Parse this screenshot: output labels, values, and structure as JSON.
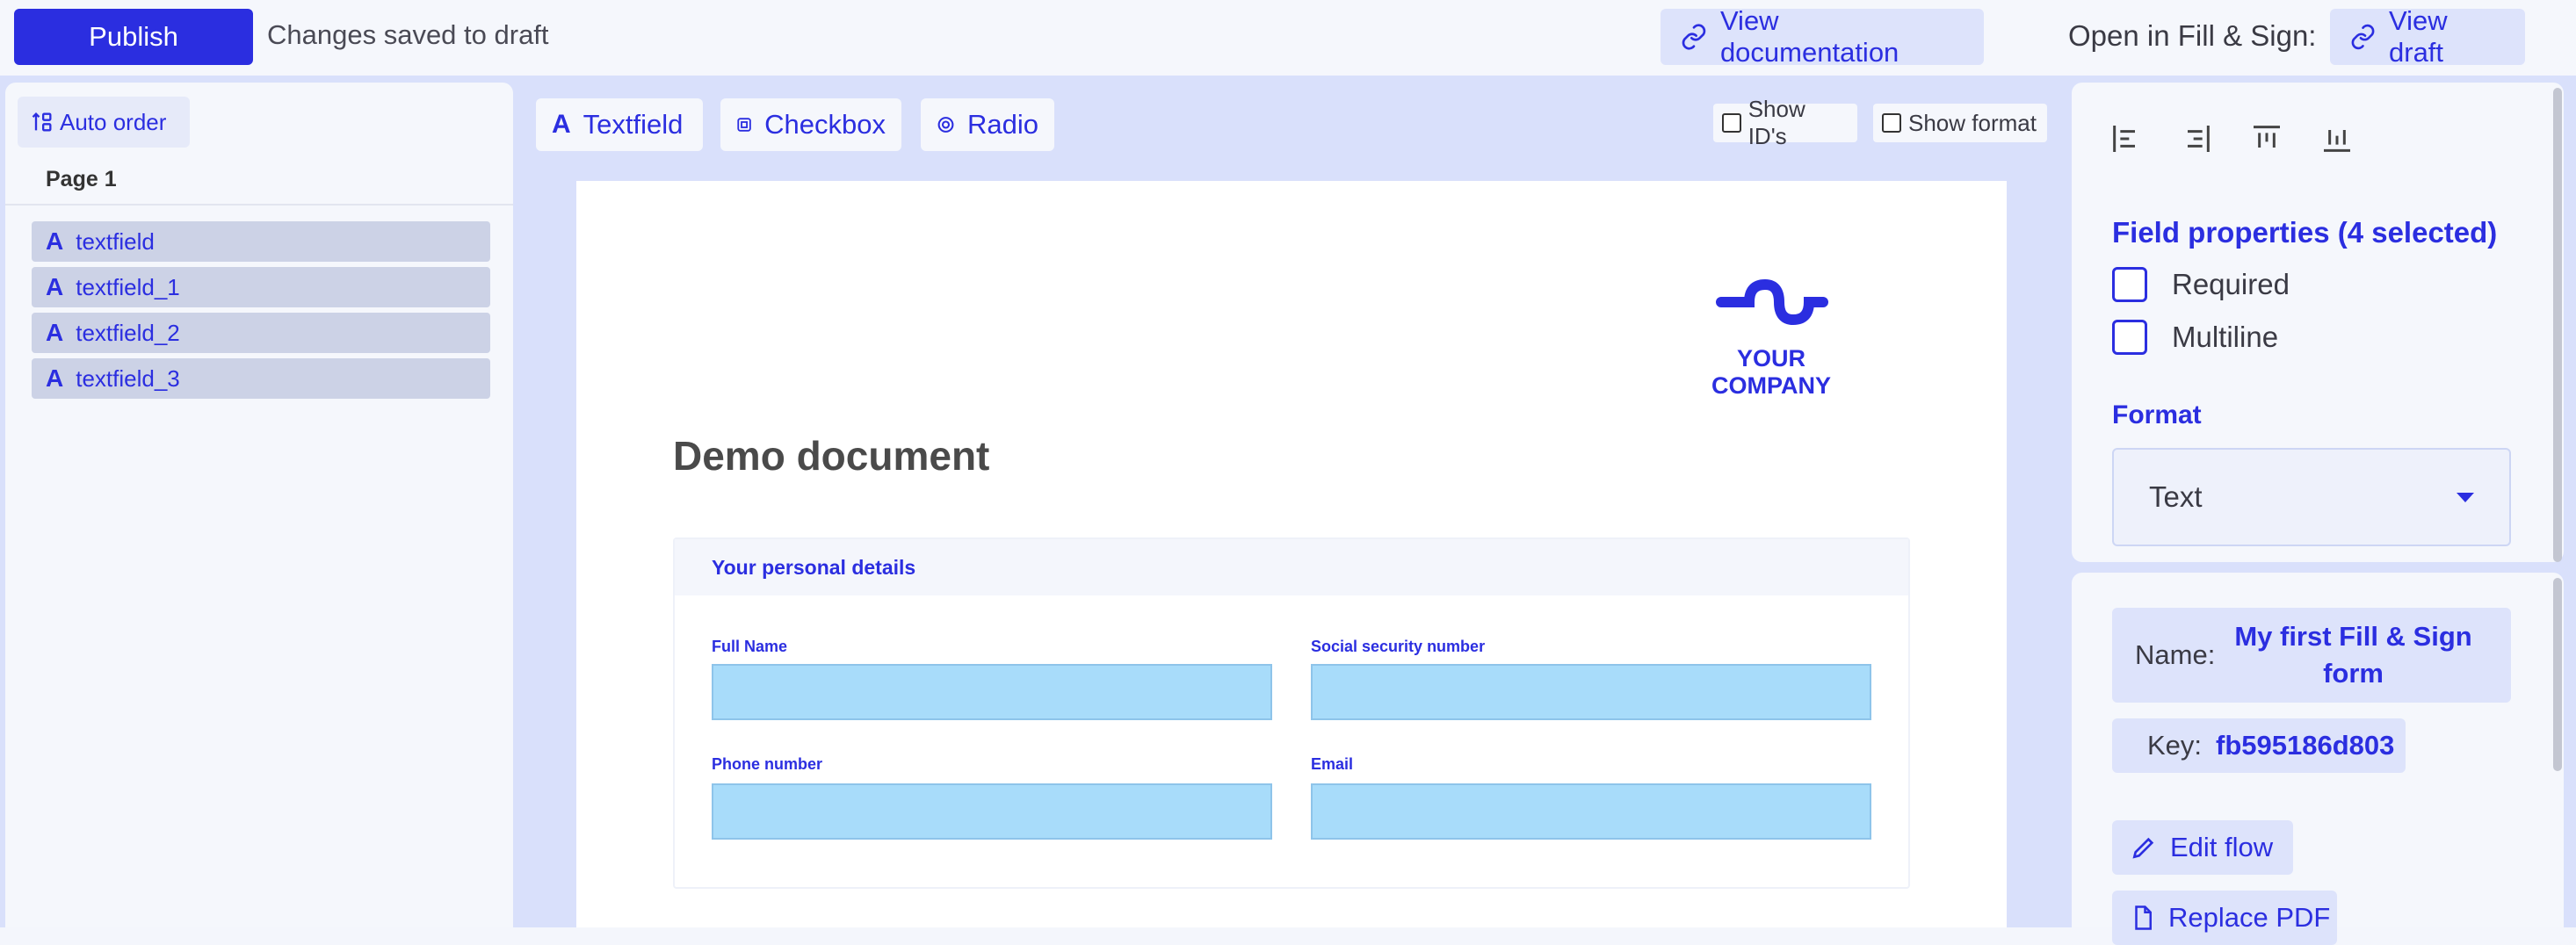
{
  "topbar": {
    "publish_label": "Publish",
    "status": "Changes saved to draft",
    "view_documentation_label": "View documentation",
    "open_in_label": "Open in Fill & Sign:",
    "view_draft_label": "View draft"
  },
  "left_panel": {
    "auto_order_label": "Auto order",
    "page_label": "Page 1",
    "fields": [
      {
        "label": "textfield"
      },
      {
        "label": "textfield_1"
      },
      {
        "label": "textfield_2"
      },
      {
        "label": "textfield_3"
      }
    ]
  },
  "toolbar": {
    "textfield_label": "Textfield",
    "checkbox_label": "Checkbox",
    "radio_label": "Radio",
    "show_ids_label": "Show ID's",
    "show_format_label": "Show format"
  },
  "document": {
    "logo_text": "YOUR COMPANY",
    "title": "Demo document",
    "section_title": "Your personal details",
    "fields": {
      "full_name": "Full Name",
      "ssn": "Social security number",
      "phone": "Phone number",
      "email": "Email"
    }
  },
  "right_panel": {
    "field_properties_heading": "Field properties (4 selected)",
    "required_label": "Required",
    "multiline_label": "Multiline",
    "format_heading": "Format",
    "format_value": "Text",
    "name_label": "Name:",
    "name_value_line1": "My first Fill & Sign",
    "name_value_line2": "form",
    "key_label": "Key:",
    "key_value": "fb595186d803",
    "edit_flow_label": "Edit flow",
    "replace_pdf_label": "Replace PDF"
  },
  "colors": {
    "accent": "#2b2ee0",
    "workspace_bg": "#d9e0fb",
    "input_fill": "#a8dcfa"
  }
}
